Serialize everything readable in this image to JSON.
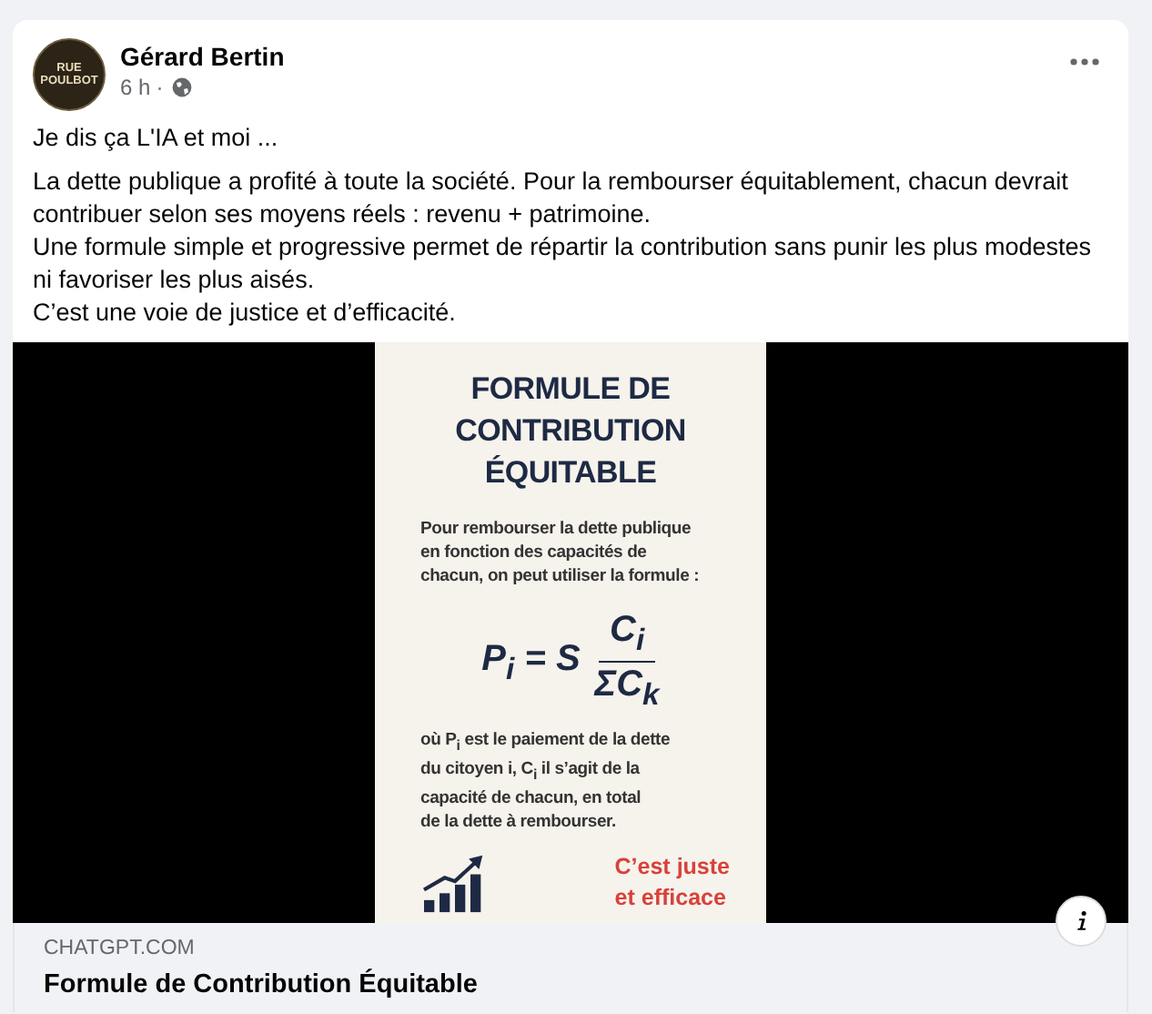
{
  "post": {
    "author": "Gérard Bertin",
    "avatar_text": [
      "RUE",
      "POULBOT"
    ],
    "time": "6 h",
    "separator": "·",
    "lead": "Je dis ça L'IA et moi ...",
    "body": [
      "La dette publique a profité à toute la société. Pour la rembourser équitablement, chacun devrait contribuer selon ses moyens réels : revenu + patrimoine.",
      "Une formule simple et progressive permet de répartir la contribution sans punir les plus modestes ni favoriser les plus aisés.",
      "C’est une voie de justice et d’efficacité."
    ],
    "link": {
      "poster": {
        "title_lines": [
          "FORMULE DE",
          "CONTRIBUTION",
          "ÉQUITABLE"
        ],
        "intro_lines": [
          "Pour rembourser la dette publique",
          "en fonction des capacités de",
          "chacun, on peut utiliser la formule :"
        ],
        "formula": {
          "left": "P$_{i}$ = S",
          "numerator": "C$_{i}$",
          "denominator": "ΣC$_{k}$"
        },
        "explanation_lines": [
          "où P$_{i}$ est le paiement de la dette",
          "du citoyen i, C$_{i}$ il s’agit de la",
          "capacité de chacun, en total",
          "de la dette à rembourser."
        ],
        "tagline_lines": [
          "C’est juste",
          "et efficace"
        ]
      },
      "domain": "CHATGPT.COM",
      "title": "Formule de Contribution Équitable"
    }
  }
}
